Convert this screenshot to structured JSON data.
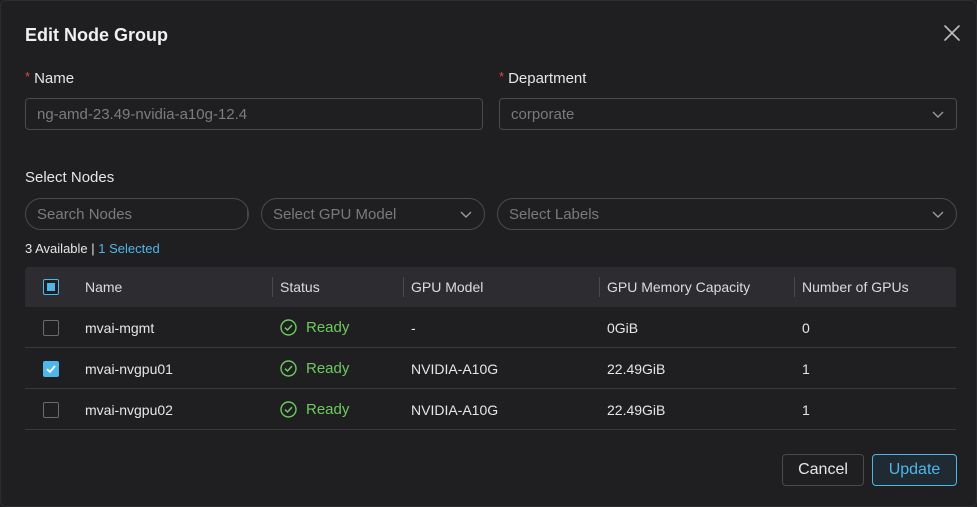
{
  "modal": {
    "title": "Edit Node Group"
  },
  "form": {
    "name": {
      "label": "Name",
      "required_mark": "*",
      "value": "ng-amd-23.49-nvidia-a10g-12.4"
    },
    "department": {
      "label": "Department",
      "required_mark": "*",
      "value": "corporate"
    }
  },
  "select_nodes": {
    "label": "Select Nodes",
    "search_placeholder": "Search Nodes",
    "gpu_model_placeholder": "Select GPU Model",
    "labels_placeholder": "Select Labels",
    "available_text": "3 Available |",
    "selected_text": "1 Selected"
  },
  "table": {
    "columns": [
      "Name",
      "Status",
      "GPU Model",
      "GPU Memory Capacity",
      "Number of GPUs"
    ],
    "rows": [
      {
        "checked": false,
        "name": "mvai-mgmt",
        "status": "Ready",
        "gpu_model": "-",
        "gpu_memory": "0GiB",
        "num_gpus": "0"
      },
      {
        "checked": true,
        "name": "mvai-nvgpu01",
        "status": "Ready",
        "gpu_model": "NVIDIA-A10G",
        "gpu_memory": "22.49GiB",
        "num_gpus": "1"
      },
      {
        "checked": false,
        "name": "mvai-nvgpu02",
        "status": "Ready",
        "gpu_model": "NVIDIA-A10G",
        "gpu_memory": "22.49GiB",
        "num_gpus": "1"
      }
    ]
  },
  "actions": {
    "cancel_label": "Cancel",
    "update_label": "Update"
  },
  "colors": {
    "accent": "#4fb6ea",
    "ready": "#6ccb5f",
    "required": "#e0483f",
    "background": "#1f1f21"
  }
}
